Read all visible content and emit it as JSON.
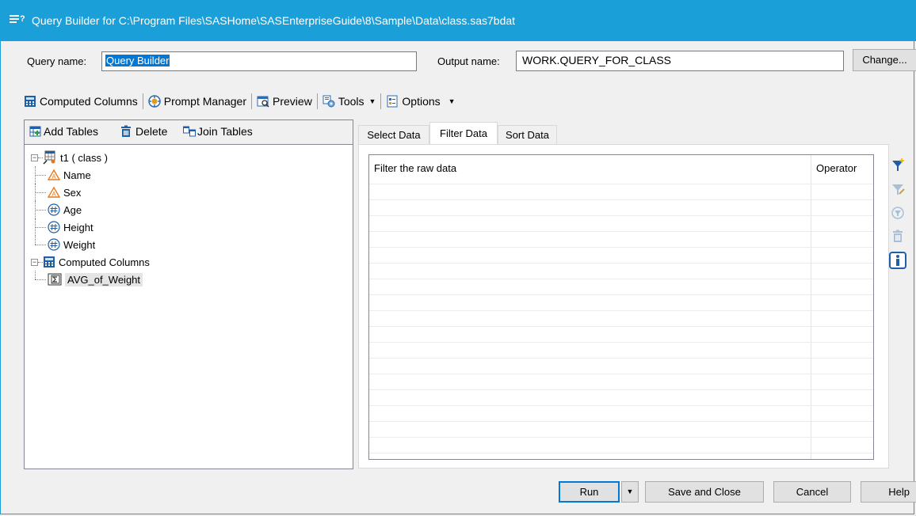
{
  "window": {
    "title": "Query Builder for C:\\Program Files\\SASHome\\SASEnterpriseGuide\\8\\Sample\\Data\\class.sas7bdat"
  },
  "query": {
    "name_label": "Query name:",
    "name_value": "Query Builder",
    "output_label": "Output name:",
    "output_value": "WORK.QUERY_FOR_CLASS",
    "change_label": "Change..."
  },
  "toolbar": {
    "computed_columns": "Computed Columns",
    "prompt_manager": "Prompt Manager",
    "preview": "Preview",
    "tools": "Tools",
    "options": "Options"
  },
  "left_toolbar": {
    "add_tables": "Add Tables",
    "delete": "Delete",
    "join_tables": "Join Tables"
  },
  "tree": {
    "table_node": "t1 ( class )",
    "columns": [
      {
        "label": "Name",
        "kind": "character"
      },
      {
        "label": "Sex",
        "kind": "character"
      },
      {
        "label": "Age",
        "kind": "numeric"
      },
      {
        "label": "Height",
        "kind": "numeric"
      },
      {
        "label": "Weight",
        "kind": "numeric"
      }
    ],
    "computed_node": "Computed Columns",
    "computed_items": [
      {
        "label": "AVG_of_Weight",
        "kind": "summary"
      }
    ]
  },
  "tabs": [
    "Select Data",
    "Filter Data",
    "Sort Data"
  ],
  "active_tab": "Filter Data",
  "filter_grid": {
    "columns": [
      "Filter the raw data",
      "Operator"
    ]
  },
  "footer": {
    "run": "Run",
    "save_close": "Save and Close",
    "cancel": "Cancel",
    "help": "Help"
  },
  "colors": {
    "titlebar": "#1a9fd9",
    "selection": "#0078d7"
  }
}
